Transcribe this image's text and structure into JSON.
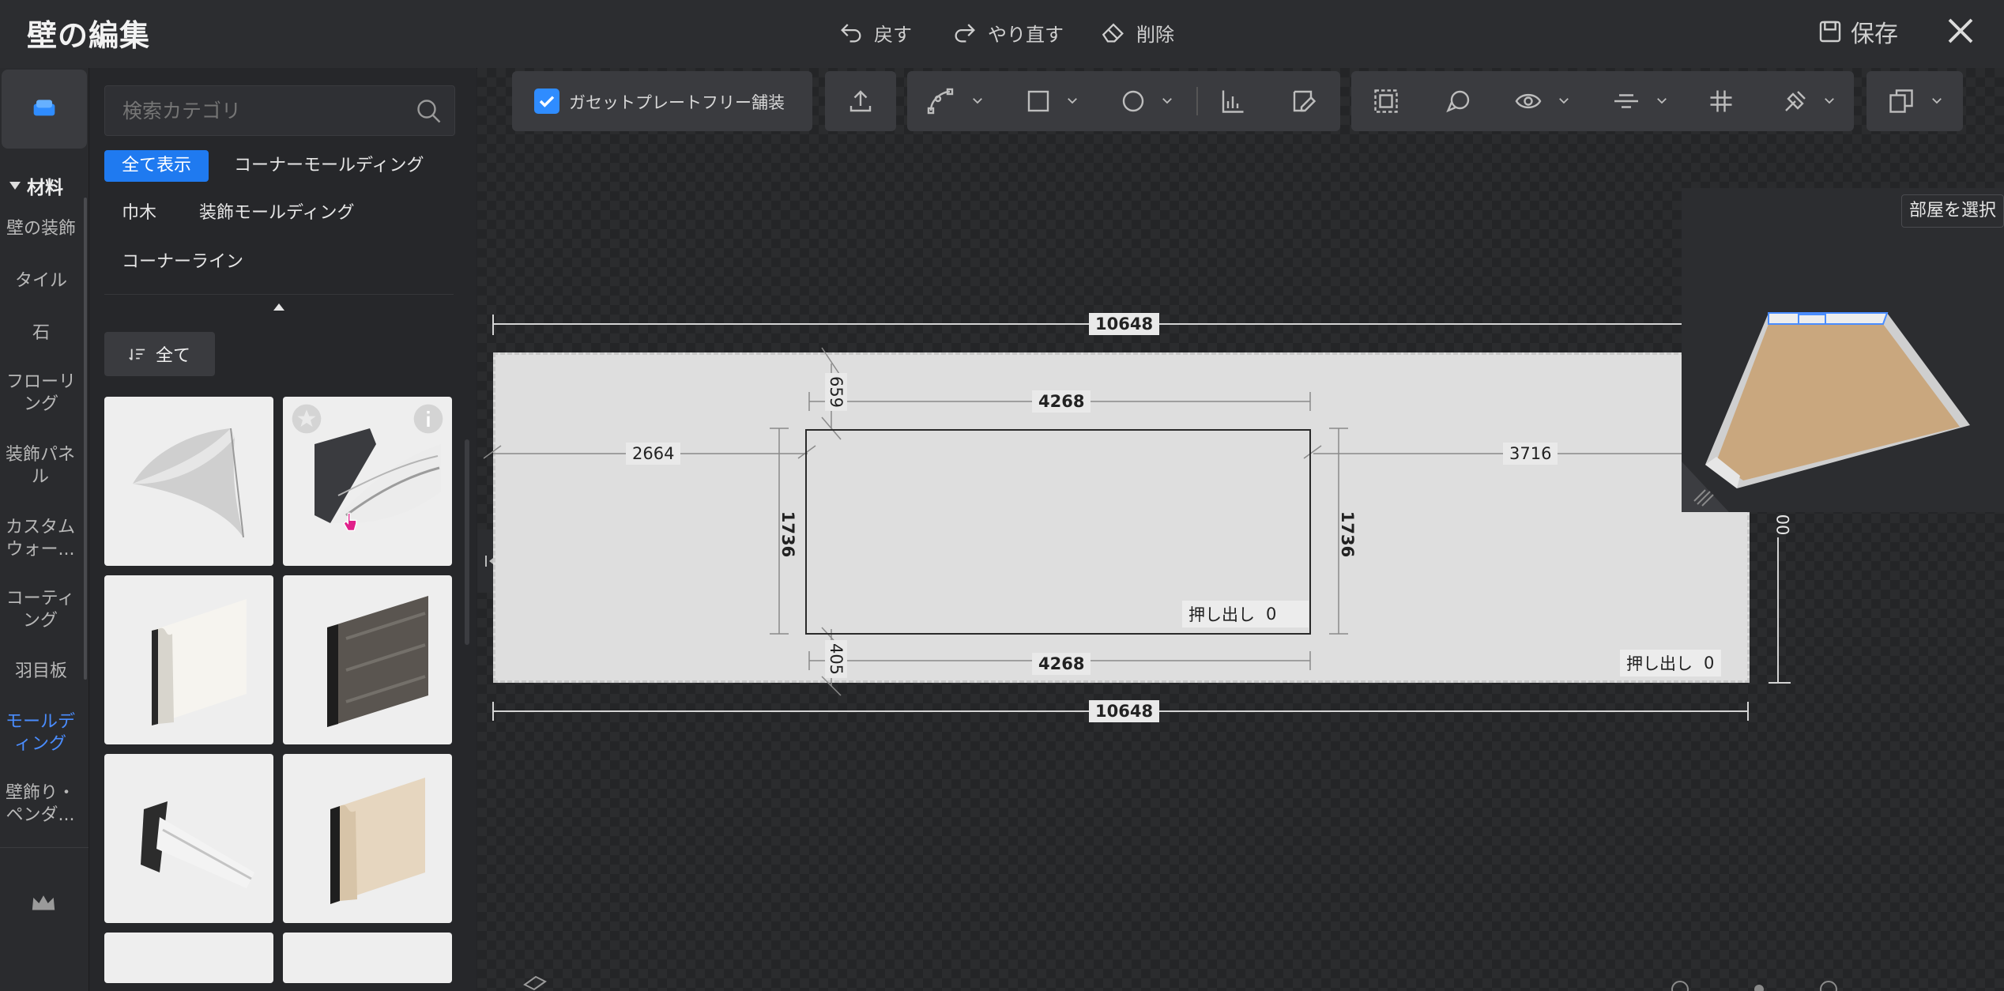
{
  "header": {
    "title": "壁の編集",
    "undo_label": "戻す",
    "redo_label": "やり直す",
    "delete_label": "削除",
    "save_label": "保存"
  },
  "rail": {
    "section_label": "材料",
    "items": [
      {
        "label": "壁の装飾"
      },
      {
        "label": "タイル"
      },
      {
        "label": "石"
      },
      {
        "label": "フローリング"
      },
      {
        "label": "装飾パネル"
      },
      {
        "label": "カスタムウォー..."
      },
      {
        "label": "コーティング"
      },
      {
        "label": "羽目板"
      },
      {
        "label": "モールディング"
      },
      {
        "label": "壁飾り・ペンダ..."
      }
    ],
    "active_index": 8,
    "accent": "#4a8dff"
  },
  "panel": {
    "search_placeholder": "検索カテゴリ",
    "chips": [
      "全て表示",
      "コーナーモールディング",
      "巾木",
      "装飾モールディング",
      "コーナーライン"
    ],
    "sort_label": "全て"
  },
  "toolbar": {
    "gusset_label": "ガセットプレートフリー舗装",
    "gusset_checked": true
  },
  "canvas": {
    "dims": {
      "total_top": "10648",
      "total_bottom": "10648",
      "opening_top": "4268",
      "opening_bottom": "4268",
      "left_gap": "2664",
      "right_gap": "3716",
      "top_gap": "659",
      "bottom_gap": "405",
      "opening_height_left": "1736",
      "opening_height_right": "1736",
      "wall_height": "00"
    },
    "extrude_label": "押し出し",
    "extrude_value_inner": "0",
    "extrude_value_outer": "0"
  },
  "preview": {
    "select_room_label": "部屋を選択"
  }
}
